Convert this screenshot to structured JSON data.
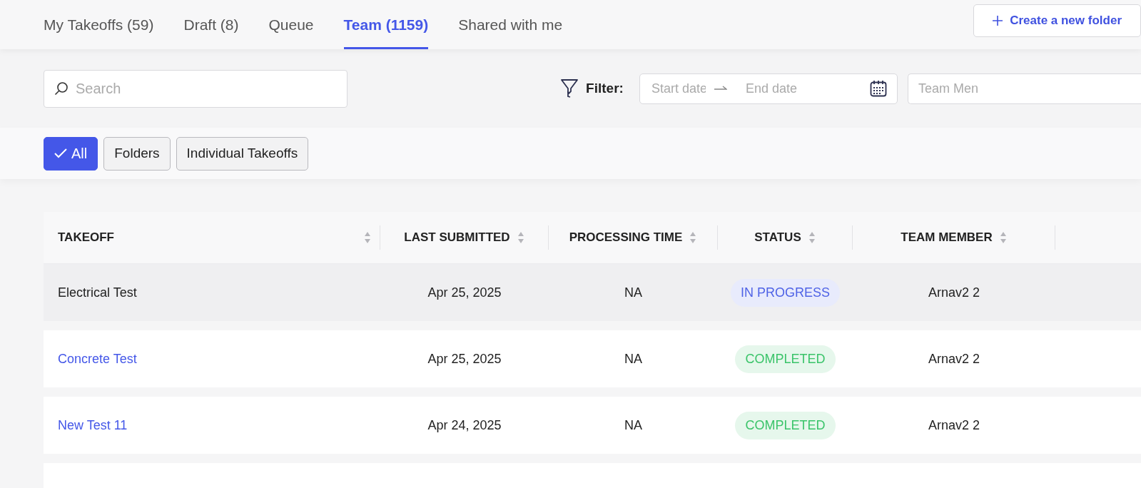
{
  "tabs": [
    {
      "label": "My Takeoffs (59)",
      "selected": false
    },
    {
      "label": "Draft (8)",
      "selected": false
    },
    {
      "label": "Queue",
      "selected": false
    },
    {
      "label": "Team (1159)",
      "selected": true
    },
    {
      "label": "Shared with me",
      "selected": false
    }
  ],
  "create_button": {
    "label": "Create a new folder"
  },
  "search": {
    "placeholder": "Search"
  },
  "filter": {
    "label": "Filter:",
    "start_placeholder": "Start date",
    "end_placeholder": "End date",
    "member_placeholder": "Team Men"
  },
  "chips": [
    {
      "label": "All",
      "selected": true
    },
    {
      "label": "Folders",
      "selected": false
    },
    {
      "label": "Individual Takeoffs",
      "selected": false
    }
  ],
  "table": {
    "columns": [
      "TAKEOFF",
      "LAST SUBMITTED",
      "PROCESSING TIME",
      "STATUS",
      "TEAM MEMBER"
    ],
    "rows": [
      {
        "takeoff": "Electrical Test",
        "linked": false,
        "highlighted": true,
        "last_submitted": "Apr 25, 2025",
        "processing_time": "NA",
        "status": "IN PROGRESS",
        "color": "#4f63e6",
        "team_member": "Arnav2 2"
      },
      {
        "takeoff": "Concrete Test",
        "linked": true,
        "highlighted": false,
        "last_submitted": "Apr 25, 2025",
        "processing_time": "NA",
        "status": "COMPLETED",
        "color": "#3bc46a",
        "team_member": "Arnav2 2"
      },
      {
        "takeoff": "New Test 11",
        "linked": true,
        "highlighted": false,
        "last_submitted": "Apr 24, 2025",
        "processing_time": "NA",
        "status": "COMPLETED",
        "color": "#3bc46a",
        "team_member": "Arnav2 2"
      }
    ]
  }
}
